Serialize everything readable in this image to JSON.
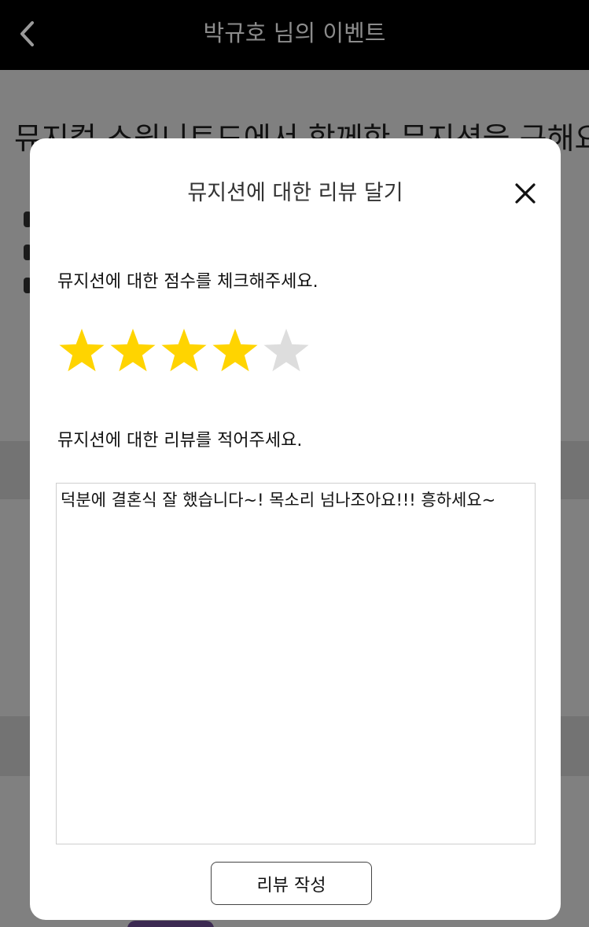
{
  "header": {
    "title": "박규호 님의 이벤트",
    "back_icon": "chevron-left-icon"
  },
  "background": {
    "headline": "뮤지컬 스윗니트드에서 함께한 뮤지션을 구해요"
  },
  "modal": {
    "title": "뮤지션에 대한 리뷰 달기",
    "close_icon": "close-icon",
    "score_label": "뮤지션에 대한 점수를 체크해주세요.",
    "rating": {
      "value": 4,
      "max": 5,
      "filled_color": "#FFD400",
      "empty_color": "#DDDDDD"
    },
    "review_label": "뮤지션에 대한 리뷰를 적어주세요.",
    "review_text": "덕분에 결혼식 잘 했습니다~! 목소리 넘나조아요!!! 흥하세요~",
    "submit_label": "리뷰 작성"
  }
}
